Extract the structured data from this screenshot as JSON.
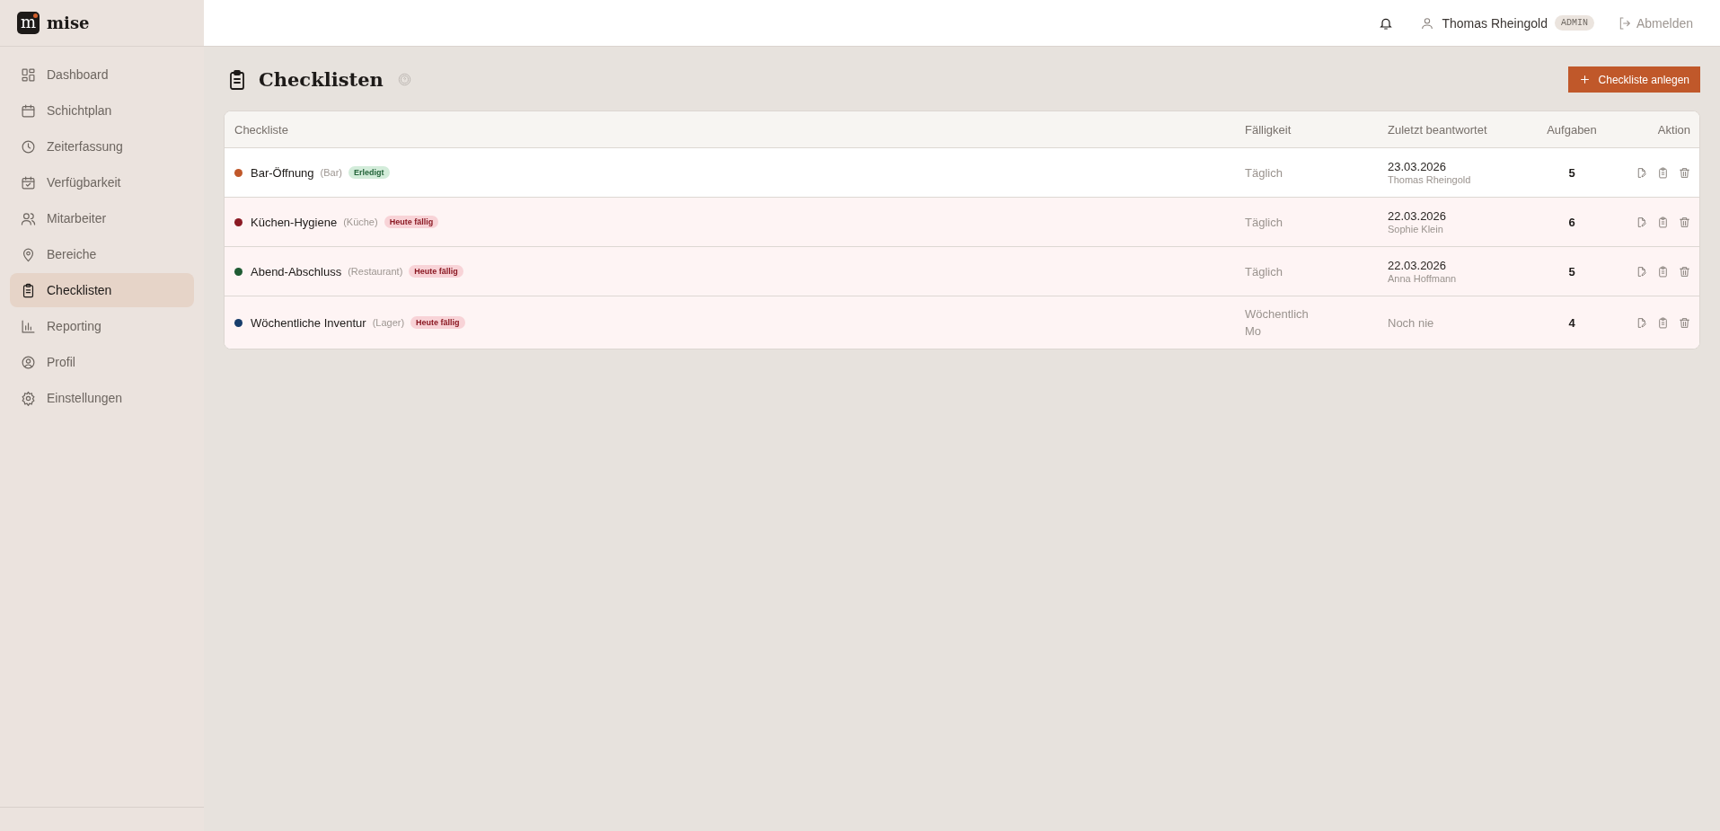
{
  "brand": {
    "logo_letter": "m",
    "name": "mise"
  },
  "nav": [
    {
      "label": "Dashboard",
      "selected": false
    },
    {
      "label": "Schichtplan",
      "selected": false
    },
    {
      "label": "Zeiterfassung",
      "selected": false
    },
    {
      "label": "Verfügbarkeit",
      "selected": false
    },
    {
      "label": "Mitarbeiter",
      "selected": false
    },
    {
      "label": "Bereiche",
      "selected": false
    },
    {
      "label": "Checklisten",
      "selected": true
    },
    {
      "label": "Reporting",
      "selected": false
    },
    {
      "label": "Profil",
      "selected": false
    },
    {
      "label": "Einstellungen",
      "selected": false
    }
  ],
  "header": {
    "user": "Thomas Rheingold",
    "role": "ADMIN",
    "logout": "Abmelden"
  },
  "page": {
    "title": "Checklisten",
    "add_button": "Checkliste anlegen"
  },
  "table": {
    "columns": [
      "Checkliste",
      "Fälligkeit",
      "Zuletzt beantwortet",
      "Aufgaben",
      "Aktion"
    ],
    "rows": [
      {
        "color": "#c0582a",
        "due_today": false,
        "checklist": {
          "name": "Bar-Öffnung",
          "area": "(Bar)",
          "badge": "Erledigt"
        },
        "due": "Täglich",
        "answered": {
          "kind": "entry",
          "date": "23.03.2026",
          "by": "Thomas Rheingold"
        },
        "tasks": "5"
      },
      {
        "color": "#8b1a24",
        "due_today": true,
        "checklist": {
          "name": "Küchen-Hygiene",
          "area": "(Küche)",
          "badge": "Heute fällig"
        },
        "due": "Täglich",
        "answered": {
          "kind": "entry",
          "date": "22.03.2026",
          "by": "Sophie Klein"
        },
        "tasks": "6"
      },
      {
        "color": "#1f5b33",
        "due_today": true,
        "checklist": {
          "name": "Abend-Abschluss",
          "area": "(Restaurant)",
          "badge": "Heute fällig"
        },
        "due": "Täglich",
        "answered": {
          "kind": "entry",
          "date": "22.03.2026",
          "by": "Anna Hoffmann"
        },
        "tasks": "5"
      },
      {
        "color": "#173d6b",
        "due_today": true,
        "checklist": {
          "name": "Wöchentliche Inventur",
          "area": "(Lager)",
          "badge": "Heute fällig"
        },
        "due": "Wöchentlich\nMo",
        "answered": {
          "kind": "never",
          "text": "Noch nie"
        },
        "tasks": "4"
      }
    ]
  }
}
